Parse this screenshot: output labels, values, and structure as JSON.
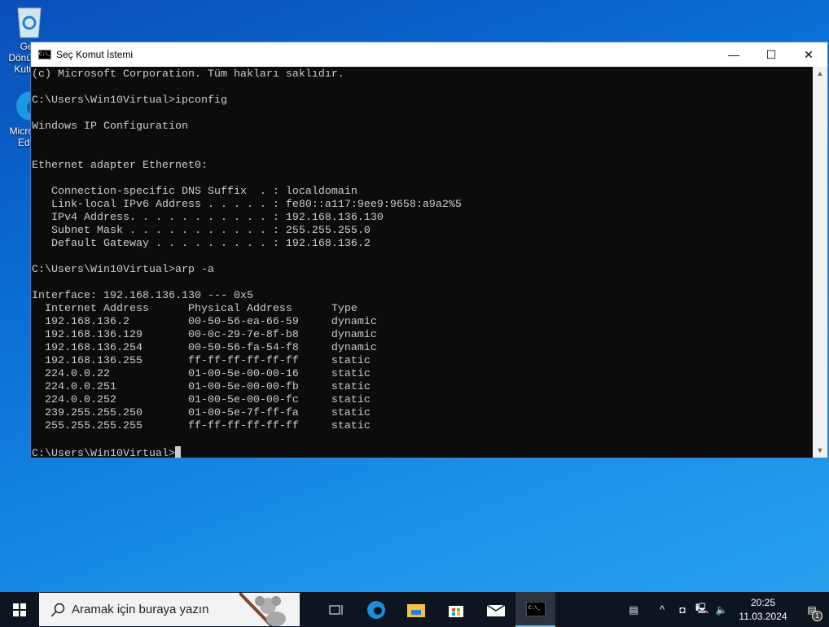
{
  "desktop": {
    "icons": [
      {
        "label": "Geri Dönüşüm Kutusu"
      },
      {
        "label": "Microsoft Edge"
      }
    ]
  },
  "window": {
    "title": "Seç Komut İstemi",
    "minimize": "—",
    "maximize": "☐",
    "close": "✕"
  },
  "console": {
    "lines": [
      "(c) Microsoft Corporation. Tüm hakları saklıdır.",
      "",
      "C:\\Users\\Win10Virtual>ipconfig",
      "",
      "Windows IP Configuration",
      "",
      "",
      "Ethernet adapter Ethernet0:",
      "",
      "   Connection-specific DNS Suffix  . : localdomain",
      "   Link-local IPv6 Address . . . . . : fe80::a117:9ee9:9658:a9a2%5",
      "   IPv4 Address. . . . . . . . . . . : 192.168.136.130",
      "   Subnet Mask . . . . . . . . . . . : 255.255.255.0",
      "   Default Gateway . . . . . . . . . : 192.168.136.2",
      "",
      "C:\\Users\\Win10Virtual>arp -a",
      "",
      "Interface: 192.168.136.130 --- 0x5",
      "  Internet Address      Physical Address      Type",
      "  192.168.136.2         00-50-56-ea-66-59     dynamic",
      "  192.168.136.129       00-0c-29-7e-8f-b8     dynamic",
      "  192.168.136.254       00-50-56-fa-54-f8     dynamic",
      "  192.168.136.255       ff-ff-ff-ff-ff-ff     static",
      "  224.0.0.22            01-00-5e-00-00-16     static",
      "  224.0.0.251           01-00-5e-00-00-fb     static",
      "  224.0.0.252           01-00-5e-00-00-fc     static",
      "  239.255.255.250       01-00-5e-7f-ff-fa     static",
      "  255.255.255.255       ff-ff-ff-ff-ff-ff     static",
      ""
    ],
    "prompt": "C:\\Users\\Win10Virtual>"
  },
  "taskbar": {
    "search_placeholder": "Aramak için buraya yazın",
    "time": "20:25",
    "date": "11.03.2024",
    "notification_count": "1"
  }
}
